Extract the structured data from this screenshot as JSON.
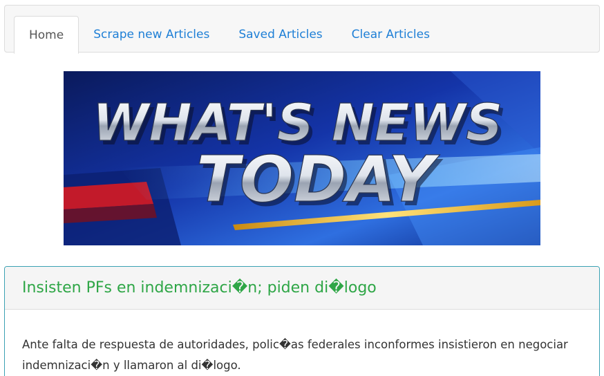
{
  "nav": {
    "tabs": [
      {
        "label": "Home",
        "active": true
      },
      {
        "label": "Scrape new Articles",
        "active": false
      },
      {
        "label": "Saved Articles",
        "active": false
      },
      {
        "label": "Clear Articles",
        "active": false
      }
    ]
  },
  "banner": {
    "line1": "WHAT'S NEWS",
    "line2": "TODAY"
  },
  "article": {
    "title": "Insisten PFs en indemnizaci�n; piden di�logo",
    "summary": "Ante falta de respuesta de autoridades, polic�as federales inconformes insistieron en negociar indemnizaci�n y llamaron al di�logo."
  },
  "colors": {
    "link": "#1e7fd6",
    "title_green": "#2ea646",
    "panel_border": "#3aa1b3"
  }
}
